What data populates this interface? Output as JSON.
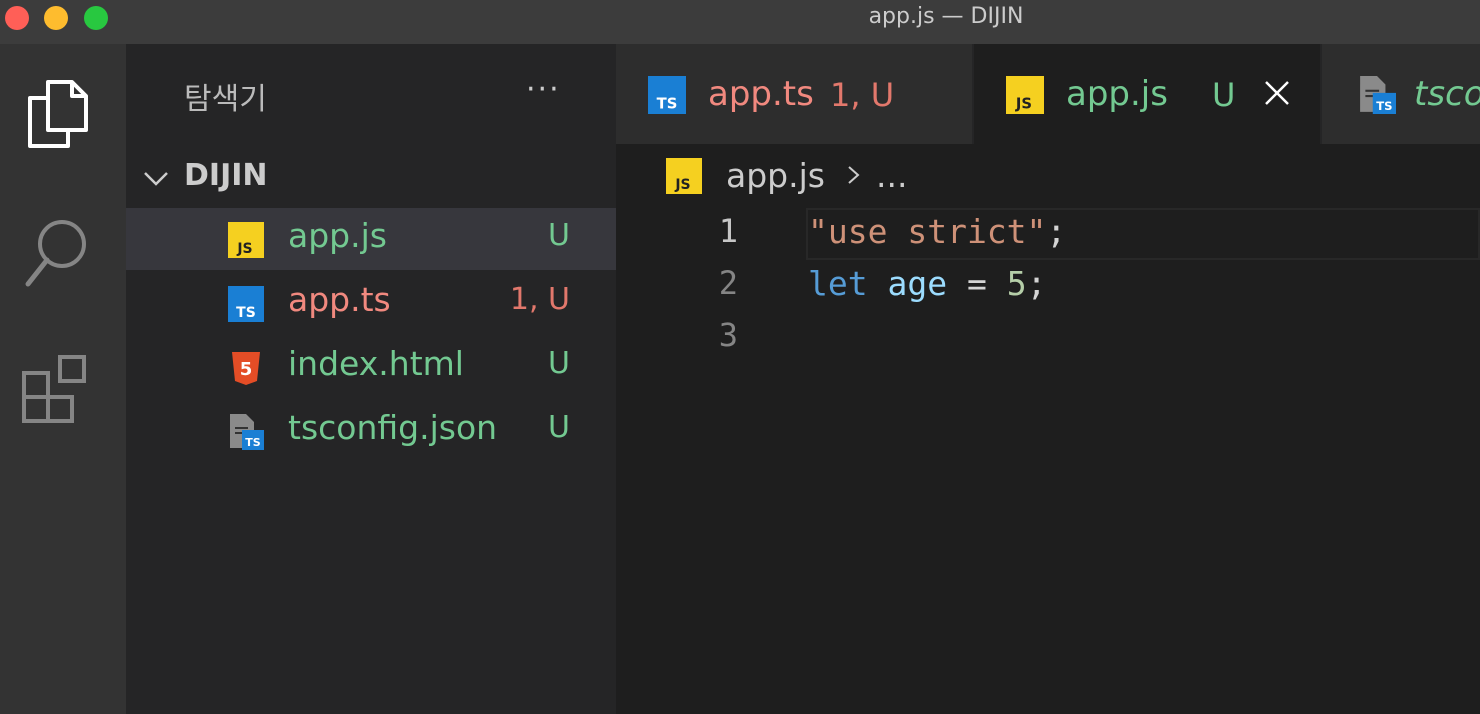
{
  "window": {
    "title": "app.js — DIJIN"
  },
  "activity_bar": {
    "icons": [
      "explorer-icon",
      "search-icon",
      "extensions-icon"
    ]
  },
  "sidebar": {
    "title": "탐색기",
    "more": "···",
    "folder": "DIJIN",
    "files": [
      {
        "name": "app.js",
        "status": "U",
        "icon": "js-file-icon",
        "color": "#73c991",
        "selected": true
      },
      {
        "name": "app.ts",
        "status": "1, U",
        "icon": "ts-file-icon",
        "color": "#f1897f"
      },
      {
        "name": "index.html",
        "status": "U",
        "icon": "html-file-icon",
        "color": "#73c991"
      },
      {
        "name": "tsconfig.json",
        "status": "U",
        "icon": "tsconfig-file-icon",
        "color": "#73c991"
      }
    ]
  },
  "tabs": [
    {
      "label": "app.ts",
      "status": "1, U",
      "icon": "ts-file-icon"
    },
    {
      "label": "app.js",
      "status": "U",
      "icon": "js-file-icon",
      "active": true
    },
    {
      "label": "tsconfig.json",
      "icon": "tsconfig-file-icon",
      "italic": true
    }
  ],
  "breadcrumb": {
    "file": "app.js",
    "more": "..."
  },
  "editor": {
    "line_numbers": [
      "1",
      "2",
      "3"
    ],
    "lines": [
      [
        {
          "text": "\"use strict\"",
          "kind": "string"
        },
        {
          "text": ";",
          "kind": "op"
        }
      ],
      [
        {
          "text": "let",
          "kind": "keyword"
        },
        {
          "text": " ",
          "kind": "op"
        },
        {
          "text": "age",
          "kind": "variable"
        },
        {
          "text": " = ",
          "kind": "op"
        },
        {
          "text": "5",
          "kind": "number"
        },
        {
          "text": ";",
          "kind": "op"
        }
      ],
      []
    ]
  },
  "colors": {
    "untracked": "#73c991",
    "error": "#e2786c",
    "js_badge": "#f5d020",
    "ts_badge": "#1a7fd4",
    "html_badge": "#e44d26"
  }
}
